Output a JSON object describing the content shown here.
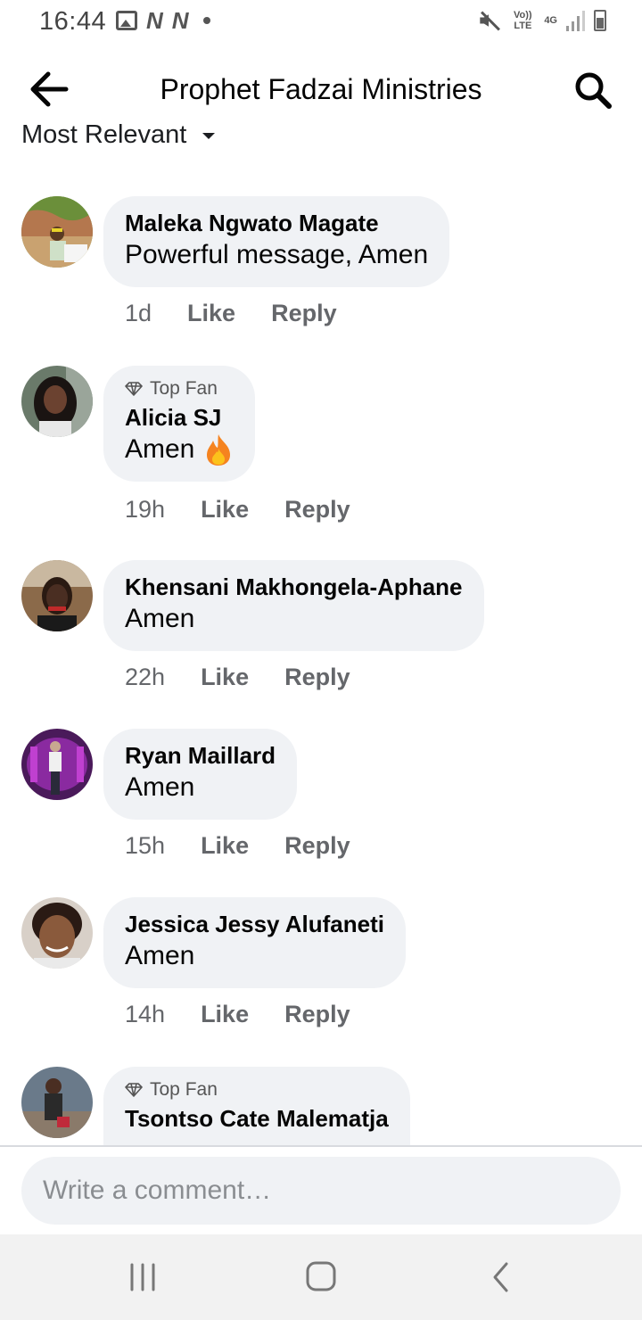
{
  "status_bar": {
    "time": "16:44",
    "left_icons": [
      "image-icon",
      "n-icon",
      "n-icon",
      "dot-icon"
    ],
    "n_glyph": "N",
    "volte": "Vo)) LTE",
    "network": "4G",
    "right_icons": [
      "mute-icon",
      "volte-icon",
      "network-4g-icon",
      "signal-icon",
      "battery-icon"
    ]
  },
  "header": {
    "title": "Prophet Fadzai Ministries",
    "back_icon": "arrow-left-icon",
    "search_icon": "search-icon"
  },
  "sort": {
    "label": "Most Relevant",
    "icon": "caret-down-icon"
  },
  "comments": [
    {
      "author": "Maleka Ngwato Magate",
      "text": "Powerful message, Amen",
      "time": "1d",
      "like": "Like",
      "reply": "Reply",
      "badge": ""
    },
    {
      "author": "Alicia SJ",
      "text": "Amen",
      "emoji": "fire-icon",
      "time": "19h",
      "like": "Like",
      "reply": "Reply",
      "badge": "Top Fan"
    },
    {
      "author": "Khensani Makhongela-Aphane",
      "text": "Amen",
      "time": "22h",
      "like": "Like",
      "reply": "Reply",
      "badge": ""
    },
    {
      "author": "Ryan Maillard",
      "text": "Amen",
      "time": "15h",
      "like": "Like",
      "reply": "Reply",
      "badge": ""
    },
    {
      "author": "Jessica Jessy Alufaneti",
      "text": "Amen",
      "time": "14h",
      "like": "Like",
      "reply": "Reply",
      "badge": ""
    },
    {
      "author": "Tsontso Cate Malematja",
      "text": "",
      "time": "",
      "like": "",
      "reply": "",
      "badge": "Top Fan"
    }
  ],
  "composer": {
    "placeholder": "Write a comment…"
  },
  "nav_bar": {
    "icons": [
      "recent-apps-icon",
      "home-icon",
      "back-icon"
    ]
  },
  "colors": {
    "bubble": "#f0f2f5",
    "secondary_text": "#65676b",
    "fire": "#f5831f"
  }
}
